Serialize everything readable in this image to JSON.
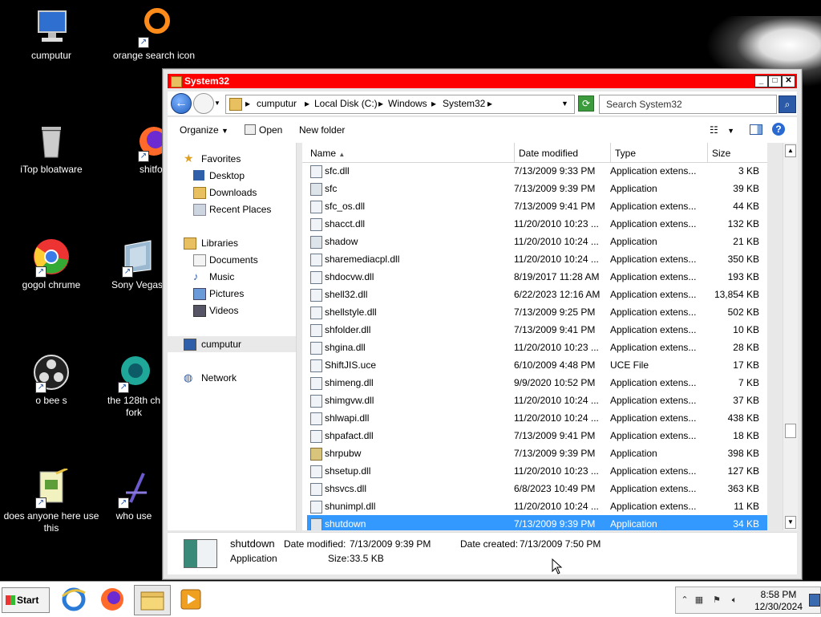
{
  "desktop": {
    "icons": [
      {
        "label": "cumputur",
        "icon": "computer-icon"
      },
      {
        "label": "orange search icon",
        "icon": "orange-ring-icon"
      },
      {
        "label": "iTop bloatware",
        "icon": "trash-can-icon"
      },
      {
        "label": "shitfo",
        "icon": "firefox-icon"
      },
      {
        "label": "gogol chrume",
        "icon": "chrome-icon"
      },
      {
        "label": "Sony Vegas",
        "icon": "sony-vegas-icon"
      },
      {
        "label": "o bee s",
        "icon": "obs-icon"
      },
      {
        "label": "the 128th ch fork",
        "icon": "browser-fork-icon"
      },
      {
        "label": "does anyone here use this",
        "icon": "notepad-icon"
      },
      {
        "label": "who use",
        "icon": "app-icon"
      }
    ]
  },
  "window": {
    "title": "System32",
    "address": {
      "crumbs": [
        "cumputur",
        "Local Disk (C:)",
        "Windows",
        "System32"
      ]
    },
    "search": {
      "placeholder": "Search System32"
    },
    "toolbar": {
      "organize": "Organize",
      "open": "Open",
      "new_folder": "New folder"
    },
    "nav": {
      "favorites": "Favorites",
      "desktop": "Desktop",
      "downloads": "Downloads",
      "recent": "Recent Places",
      "libraries": "Libraries",
      "documents": "Documents",
      "music": "Music",
      "pictures": "Pictures",
      "videos": "Videos",
      "computer": "cumputur",
      "network": "Network"
    },
    "columns": {
      "name": "Name",
      "date": "Date modified",
      "type": "Type",
      "size": "Size"
    },
    "files": [
      {
        "name": "sfc.dll",
        "date": "7/13/2009 9:33 PM",
        "type": "Application extens...",
        "size": "3 KB"
      },
      {
        "name": "sfc",
        "date": "7/13/2009 9:39 PM",
        "type": "Application",
        "size": "39 KB"
      },
      {
        "name": "sfc_os.dll",
        "date": "7/13/2009 9:41 PM",
        "type": "Application extens...",
        "size": "44 KB"
      },
      {
        "name": "shacct.dll",
        "date": "11/20/2010 10:23 ...",
        "type": "Application extens...",
        "size": "132 KB"
      },
      {
        "name": "shadow",
        "date": "11/20/2010 10:24 ...",
        "type": "Application",
        "size": "21 KB"
      },
      {
        "name": "sharemediacpl.dll",
        "date": "11/20/2010 10:24 ...",
        "type": "Application extens...",
        "size": "350 KB"
      },
      {
        "name": "shdocvw.dll",
        "date": "8/19/2017 11:28 AM",
        "type": "Application extens...",
        "size": "193 KB"
      },
      {
        "name": "shell32.dll",
        "date": "6/22/2023 12:16 AM",
        "type": "Application extens...",
        "size": "13,854 KB"
      },
      {
        "name": "shellstyle.dll",
        "date": "7/13/2009 9:25 PM",
        "type": "Application extens...",
        "size": "502 KB"
      },
      {
        "name": "shfolder.dll",
        "date": "7/13/2009 9:41 PM",
        "type": "Application extens...",
        "size": "10 KB"
      },
      {
        "name": "shgina.dll",
        "date": "11/20/2010 10:23 ...",
        "type": "Application extens...",
        "size": "28 KB"
      },
      {
        "name": "ShiftJIS.uce",
        "date": "6/10/2009 4:48 PM",
        "type": "UCE File",
        "size": "17 KB"
      },
      {
        "name": "shimeng.dll",
        "date": "9/9/2020 10:52 PM",
        "type": "Application extens...",
        "size": "7 KB"
      },
      {
        "name": "shimgvw.dll",
        "date": "11/20/2010 10:24 ...",
        "type": "Application extens...",
        "size": "37 KB"
      },
      {
        "name": "shlwapi.dll",
        "date": "11/20/2010 10:24 ...",
        "type": "Application extens...",
        "size": "438 KB"
      },
      {
        "name": "shpafact.dll",
        "date": "7/13/2009 9:41 PM",
        "type": "Application extens...",
        "size": "18 KB"
      },
      {
        "name": "shrpubw",
        "date": "7/13/2009 9:39 PM",
        "type": "Application",
        "size": "398 KB"
      },
      {
        "name": "shsetup.dll",
        "date": "11/20/2010 10:23 ...",
        "type": "Application extens...",
        "size": "127 KB"
      },
      {
        "name": "shsvcs.dll",
        "date": "6/8/2023 10:49 PM",
        "type": "Application extens...",
        "size": "363 KB"
      },
      {
        "name": "shunimpl.dll",
        "date": "11/20/2010 10:24 ...",
        "type": "Application extens...",
        "size": "11 KB"
      },
      {
        "name": "shutdown",
        "date": "7/13/2009 9:39 PM",
        "type": "Application",
        "size": "34 KB"
      }
    ],
    "details": {
      "name": "shutdown",
      "type": "Application",
      "modified_label": "Date modified:",
      "modified": "7/13/2009 9:39 PM",
      "created_label": "Date created:",
      "created": "7/13/2009 7:50 PM",
      "size_label": "Size:",
      "size": "33.5 KB"
    }
  },
  "taskbar": {
    "start": "Start",
    "apps": [
      "internet-explorer-icon",
      "firefox-icon",
      "file-explorer-icon",
      "media-player-icon"
    ],
    "clock_time": "8:58 PM",
    "clock_date": "12/30/2024"
  },
  "colors": {
    "titlebar": "#ff0000",
    "selection": "#3399ff"
  }
}
